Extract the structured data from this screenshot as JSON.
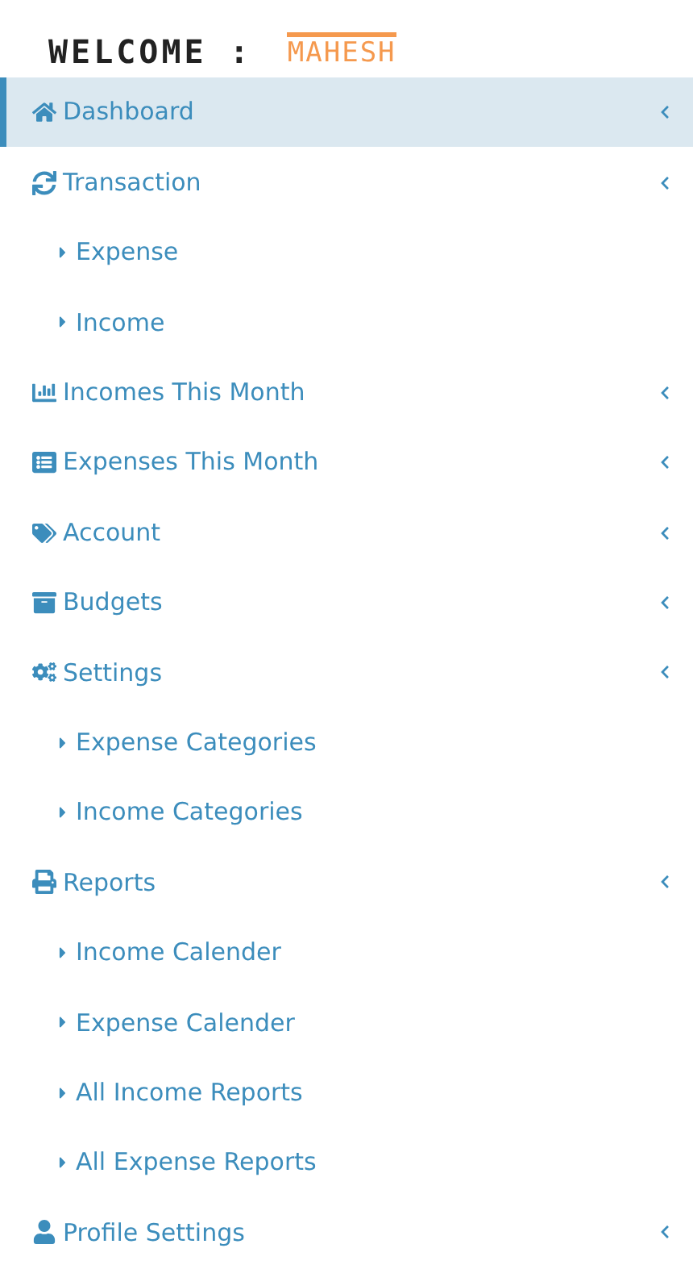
{
  "header": {
    "greeting": "WELCOME :",
    "user": "MAHESH"
  },
  "menu": [
    {
      "label": "Dashboard",
      "selected": true
    },
    {
      "label": "Transaction",
      "selected": false,
      "children": [
        {
          "label": "Expense"
        },
        {
          "label": "Income"
        }
      ]
    },
    {
      "label": "Incomes This Month",
      "selected": false
    },
    {
      "label": "Expenses This Month",
      "selected": false
    },
    {
      "label": "Account",
      "selected": false
    },
    {
      "label": "Budgets",
      "selected": false
    },
    {
      "label": "Settings",
      "selected": false,
      "children": [
        {
          "label": "Expense Categories"
        },
        {
          "label": "Income Categories"
        }
      ]
    },
    {
      "label": "Reports",
      "selected": false,
      "children": [
        {
          "label": "Income Calender"
        },
        {
          "label": "Expense Calender"
        },
        {
          "label": "All Income Reports"
        },
        {
          "label": "All Expense Reports"
        }
      ]
    },
    {
      "label": "Profile Settings",
      "selected": false
    }
  ]
}
